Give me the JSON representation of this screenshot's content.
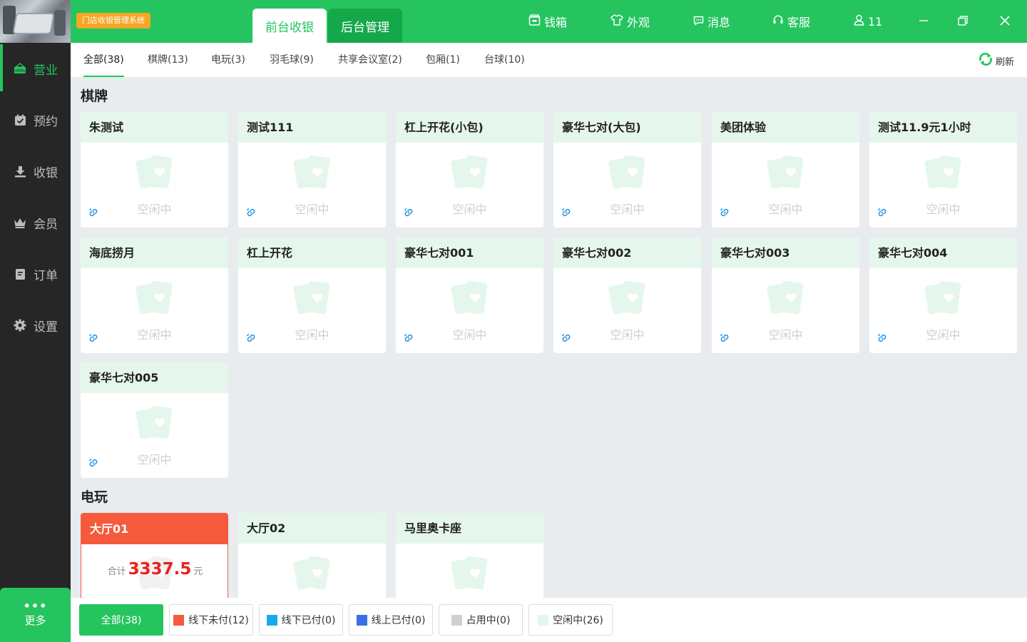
{
  "app": {
    "badge": "门店收银管理系统"
  },
  "header": {
    "tabs": [
      {
        "label": "前台收银"
      },
      {
        "label": "后台管理"
      }
    ],
    "actions": [
      {
        "label": "钱箱"
      },
      {
        "label": "外观"
      },
      {
        "label": "消息"
      },
      {
        "label": "客服"
      },
      {
        "label": "11"
      }
    ]
  },
  "sidebar": {
    "items": [
      {
        "label": "营业"
      },
      {
        "label": "预约"
      },
      {
        "label": "收银"
      },
      {
        "label": "会员"
      },
      {
        "label": "订单"
      },
      {
        "label": "设置"
      }
    ],
    "more": {
      "dots": "•••",
      "label": "更多"
    }
  },
  "categories": [
    {
      "label": "全部(38)"
    },
    {
      "label": "棋牌(13)"
    },
    {
      "label": "电玩(3)"
    },
    {
      "label": "羽毛球(9)"
    },
    {
      "label": "共享会议室(2)"
    },
    {
      "label": "包厢(1)"
    },
    {
      "label": "台球(10)"
    }
  ],
  "refresh_label": "刷新",
  "sections": [
    {
      "title": "棋牌",
      "cards": [
        {
          "name": "朱测试",
          "status": "空闲中"
        },
        {
          "name": "测试111",
          "status": "空闲中"
        },
        {
          "name": "杠上开花(小包)",
          "status": "空闲中"
        },
        {
          "name": "豪华七对(大包)",
          "status": "空闲中"
        },
        {
          "name": "美团体验",
          "status": "空闲中"
        },
        {
          "name": "测试11.9元1小时",
          "status": "空闲中"
        },
        {
          "name": "海底捞月",
          "status": "空闲中"
        },
        {
          "name": "杠上开花",
          "status": "空闲中"
        },
        {
          "name": "豪华七对001",
          "status": "空闲中"
        },
        {
          "name": "豪华七对002",
          "status": "空闲中"
        },
        {
          "name": "豪华七对003",
          "status": "空闲中"
        },
        {
          "name": "豪华七对004",
          "status": "空闲中"
        },
        {
          "name": "豪华七对005",
          "status": "空闲中"
        }
      ]
    },
    {
      "title": "电玩",
      "cards": [
        {
          "name": "大厅01",
          "total_label": "合计",
          "total": "3337.5",
          "unit": "元"
        },
        {
          "name": "大厅02"
        },
        {
          "name": "马里奥卡座"
        }
      ]
    }
  ],
  "filters": [
    {
      "label": "全部(38)"
    },
    {
      "label": "线下未付(12)",
      "color": "#f55a3c"
    },
    {
      "label": "线下已付(0)",
      "color": "#17a9f0"
    },
    {
      "label": "线上已付(0)",
      "color": "#3a6ee8"
    },
    {
      "label": "占用中(0)",
      "color": "#cfcfd4"
    },
    {
      "label": "空闲中(26)",
      "color": "#e5f7ec"
    }
  ],
  "colors": {
    "primary": "#25c45f",
    "busy": "#f55a3c",
    "idle_header": "#e5f7ec",
    "amount": "#e8211c"
  }
}
